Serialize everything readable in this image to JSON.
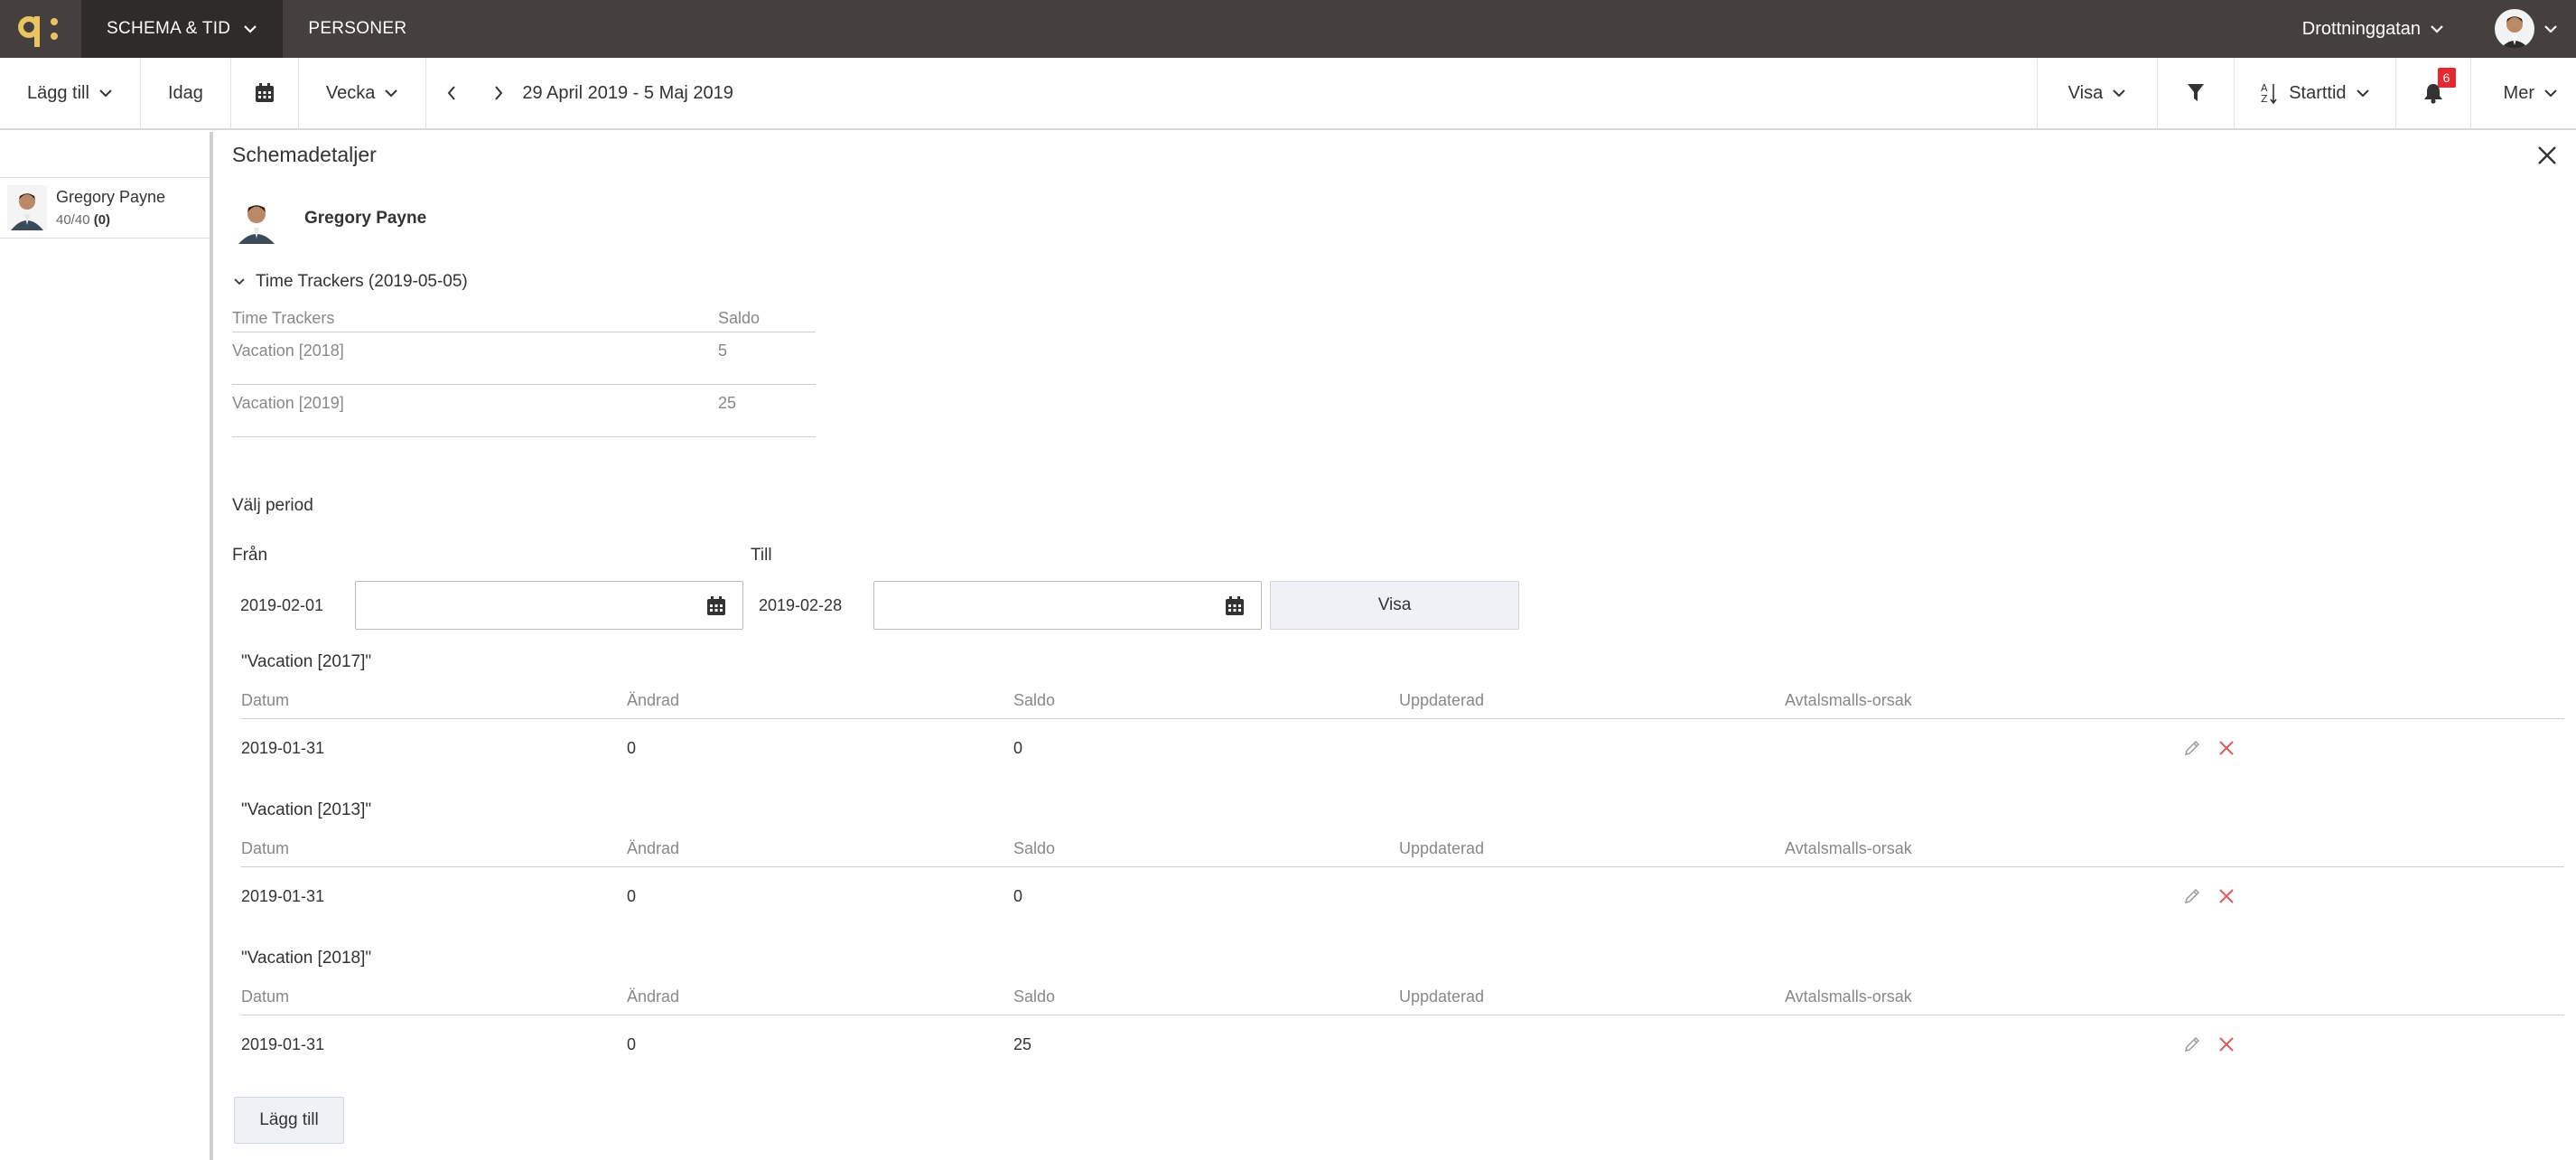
{
  "topbar": {
    "nav": [
      {
        "label": "SCHEMA & TID",
        "active": true
      },
      {
        "label": "PERSONER",
        "active": false
      }
    ],
    "location": "Drottninggatan"
  },
  "toolbar": {
    "add_label": "Lägg till",
    "today_label": "Idag",
    "view_mode": "Vecka",
    "date_range": "29 April 2019 - 5 Maj 2019",
    "show_label": "Visa",
    "sort_label": "Starttid",
    "notifications_count": "6",
    "more_label": "Mer"
  },
  "sidebar": {
    "person": {
      "name": "Gregory Payne",
      "hours": "40/40",
      "extra": "(0)"
    }
  },
  "panel": {
    "title": "Schemadetaljer",
    "employee_name": "Gregory Payne",
    "tt_section_title": "Time Trackers (2019-05-05)",
    "tt_headers": {
      "tracker": "Time Trackers",
      "balance": "Saldo"
    },
    "tt_rows": [
      {
        "name": "Vacation [2018]",
        "balance": "5"
      },
      {
        "name": "Vacation [2019]",
        "balance": "25"
      }
    ],
    "period_title": "Välj period",
    "from_label": "Från",
    "from_value": "2019-02-01",
    "to_label": "Till",
    "to_value": "2019-02-28",
    "show_button": "Visa",
    "columns": {
      "date": "Datum",
      "changed": "Ändrad",
      "balance": "Saldo",
      "updated": "Uppdaterad",
      "reason": "Avtalsmalls-orsak"
    },
    "vacations": [
      {
        "title": "\"Vacation [2017]\"",
        "row": {
          "date": "2019-01-31",
          "changed": "0",
          "balance": "0",
          "updated": "",
          "reason": ""
        }
      },
      {
        "title": "\"Vacation [2013]\"",
        "row": {
          "date": "2019-01-31",
          "changed": "0",
          "balance": "0",
          "updated": "",
          "reason": ""
        }
      },
      {
        "title": "\"Vacation [2018]\"",
        "row": {
          "date": "2019-01-31",
          "changed": "0",
          "balance": "25",
          "updated": "",
          "reason": ""
        }
      }
    ],
    "add_button": "Lägg till"
  },
  "colors": {
    "topbar_bg": "#45403d",
    "active_nav_bg": "#2f2b29",
    "logo_accent": "#e8c560",
    "badge_red": "#e8262d",
    "delete_red": "#e05a5a"
  }
}
